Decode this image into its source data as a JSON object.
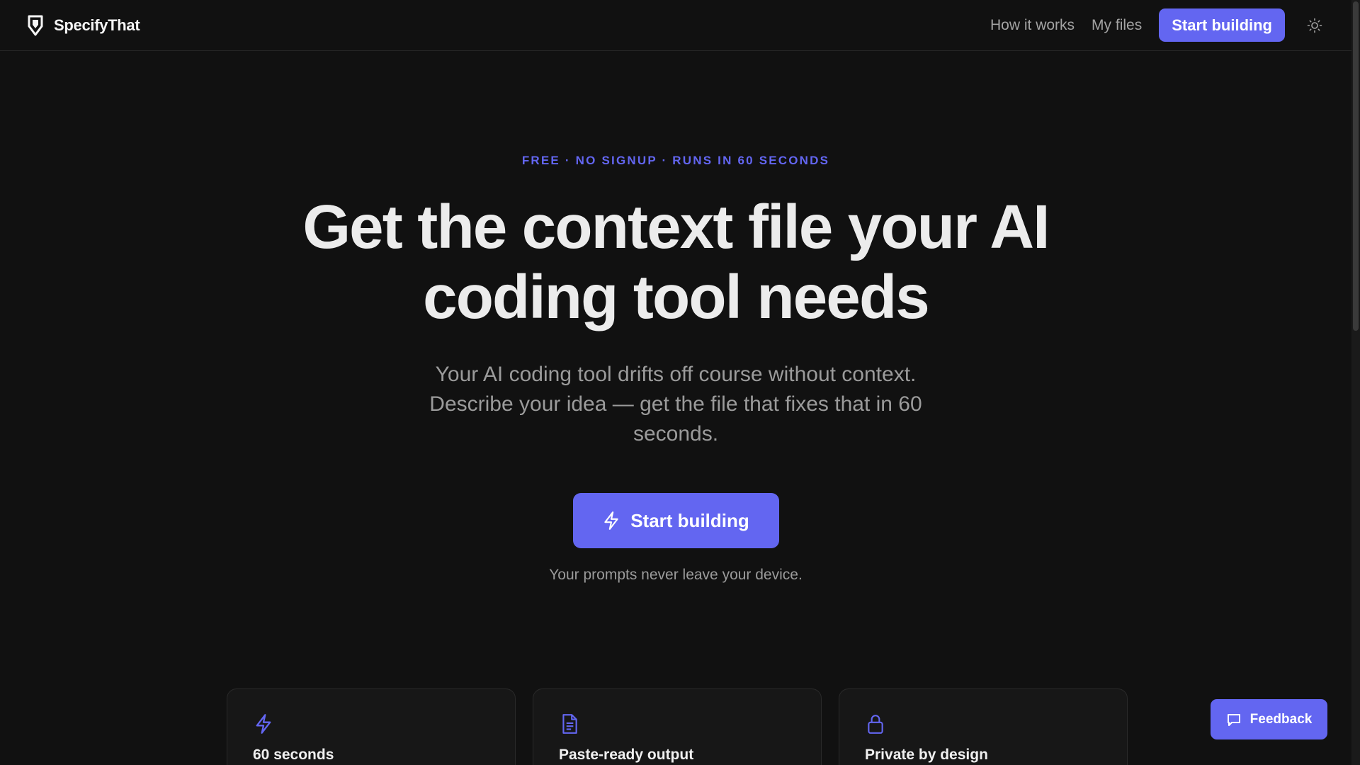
{
  "header": {
    "brand_name": "SpecifyThat",
    "nav": {
      "how_it_works": "How it works",
      "my_files": "My files",
      "cta": "Start building"
    },
    "theme_icon": "sun-icon"
  },
  "hero": {
    "eyebrow": "FREE · NO SIGNUP · RUNS IN 60 SECONDS",
    "headline": "Get the context file your AI coding tool needs",
    "subhead": "Your AI coding tool drifts off course without context. Describe your idea — get the file that fixes that in 60 seconds.",
    "cta": "Start building",
    "cta_icon": "lightning-icon",
    "privacy_note": "Your prompts never leave your device."
  },
  "features": [
    {
      "icon": "lightning-icon",
      "title": "60 seconds"
    },
    {
      "icon": "document-icon",
      "title": "Paste-ready output"
    },
    {
      "icon": "lock-icon",
      "title": "Private by design"
    }
  ],
  "feedback": {
    "label": "Feedback",
    "icon": "message-icon"
  },
  "colors": {
    "background": "#111111",
    "accent": "#6366f1",
    "text_primary": "#ececec",
    "text_muted": "#9b9b9b"
  }
}
